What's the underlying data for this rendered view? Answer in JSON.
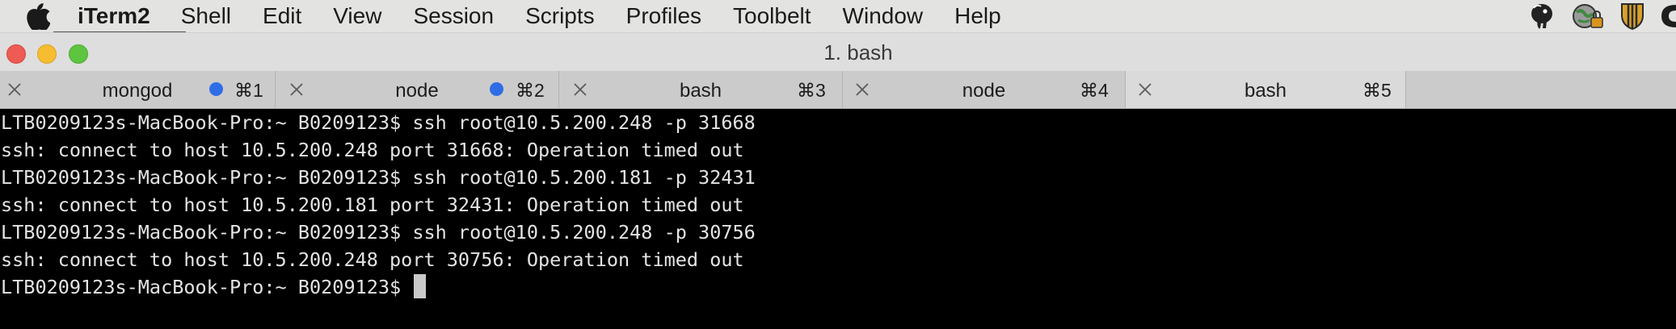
{
  "menubar": {
    "apple_icon": "apple-logo-icon",
    "items": [
      "iTerm2",
      "Shell",
      "Edit",
      "View",
      "Session",
      "Scripts",
      "Profiles",
      "Toolbelt",
      "Window",
      "Help"
    ],
    "status_icons": [
      "elephant-icon",
      "globe-lock-icon",
      "shield-icon",
      "partial-icon"
    ]
  },
  "window": {
    "title": "1. bash",
    "traffic_colors": {
      "close": "#ee5b55",
      "minimize": "#f5bd2f",
      "zoom": "#5ec540"
    }
  },
  "tabs": [
    {
      "label": "mongod",
      "shortcut": "⌘1",
      "activity_dot": true,
      "active": false
    },
    {
      "label": "node",
      "shortcut": "⌘2",
      "activity_dot": true,
      "active": false
    },
    {
      "label": "bash",
      "shortcut": "⌘3",
      "activity_dot": false,
      "active": false
    },
    {
      "label": "node",
      "shortcut": "⌘4",
      "activity_dot": false,
      "active": false
    },
    {
      "label": "bash",
      "shortcut": "⌘5",
      "activity_dot": false,
      "active": true
    }
  ],
  "terminal": {
    "lines": [
      "LTB0209123s-MacBook-Pro:~ B0209123$ ssh root@10.5.200.248 -p 31668",
      "ssh: connect to host 10.5.200.248 port 31668: Operation timed out",
      "LTB0209123s-MacBook-Pro:~ B0209123$ ssh root@10.5.200.181 -p 32431",
      "ssh: connect to host 10.5.200.181 port 32431: Operation timed out",
      "LTB0209123s-MacBook-Pro:~ B0209123$ ssh root@10.5.200.248 -p 30756",
      "ssh: connect to host 10.5.200.248 port 30756: Operation timed out"
    ],
    "prompt": "LTB0209123s-MacBook-Pro:~ B0209123$ "
  },
  "colors": {
    "activity_dot": "#2f6de6",
    "terminal_bg": "#000000",
    "terminal_fg": "#e4e4e4"
  }
}
